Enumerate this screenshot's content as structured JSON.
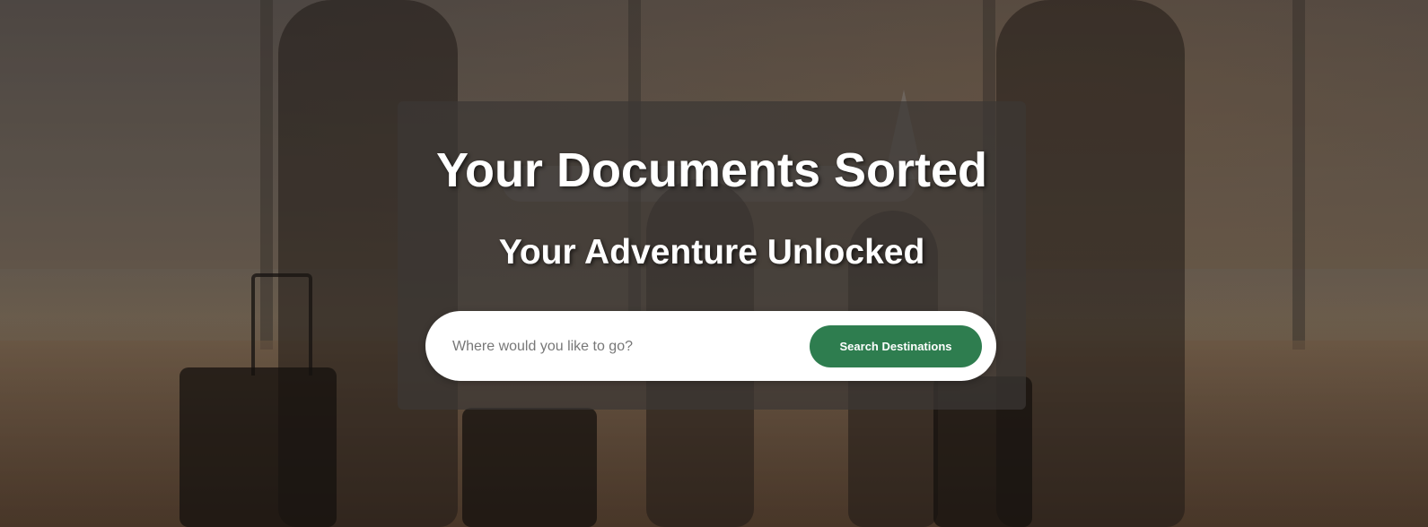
{
  "hero": {
    "title": "Your Documents Sorted",
    "subtitle": "Your Adventure Unlocked",
    "background_image": "family walking with luggage at airport terminal"
  },
  "search": {
    "placeholder": "Where would you like to go?",
    "value": "",
    "button_label": "Search Destinations"
  },
  "colors": {
    "button_bg": "#2e7d4f",
    "panel_bg": "rgba(60,55,52,0.72)",
    "text": "#ffffff"
  }
}
